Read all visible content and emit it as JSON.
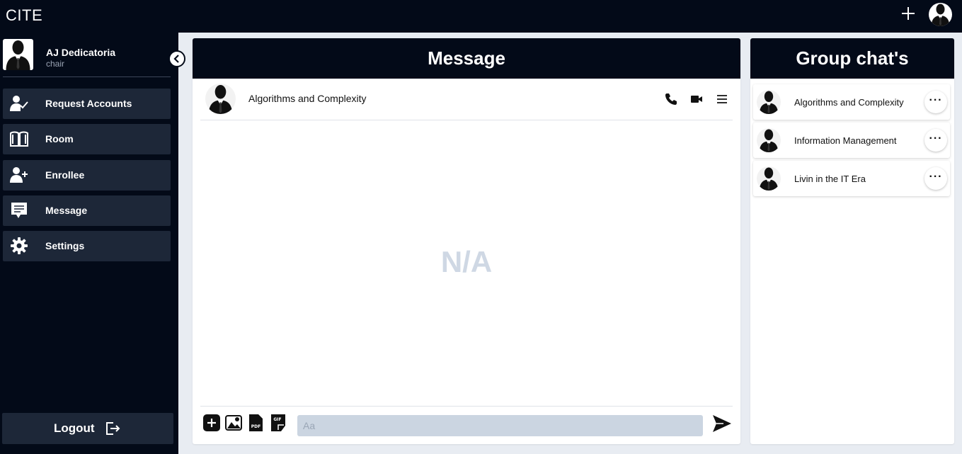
{
  "app": {
    "brand": "CITE"
  },
  "user": {
    "name": "AJ Dedicatoria",
    "role": "chair"
  },
  "sidebar": {
    "items": [
      {
        "label": "Request Accounts",
        "icon": "user-check-icon"
      },
      {
        "label": "Room",
        "icon": "book-open-icon"
      },
      {
        "label": "Enrollee",
        "icon": "user-plus-icon"
      },
      {
        "label": "Message",
        "icon": "chat-bubble-icon"
      },
      {
        "label": "Settings",
        "icon": "gear-icon"
      }
    ],
    "logout_label": "Logout"
  },
  "message_panel": {
    "title": "Message",
    "active_chat": "Algorithms and Complexity",
    "empty_text": "N/A",
    "input_placeholder": "Aa"
  },
  "groups_panel": {
    "title": "Group chat's",
    "groups": [
      {
        "name": "Algorithms and Complexity"
      },
      {
        "name": "Information Management"
      },
      {
        "name": "Livin in the IT Era"
      }
    ],
    "more_label": "···"
  },
  "colors": {
    "dark": "#030a18",
    "nav_item": "#1d2738",
    "background": "#e8ecf2",
    "input": "#cbd5e1",
    "empty_text": "#cfd8e4"
  }
}
